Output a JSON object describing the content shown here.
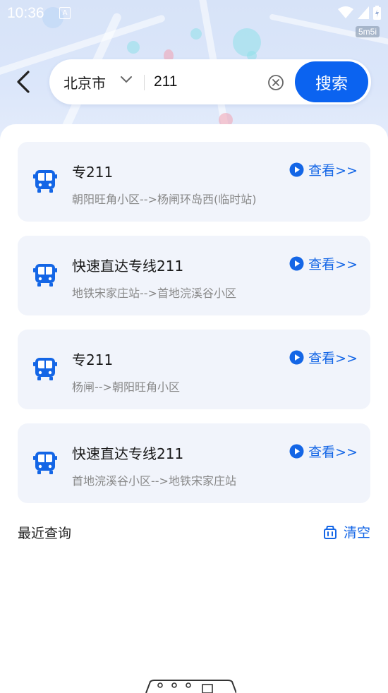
{
  "status_bar": {
    "time": "10:36",
    "notification_letter": "A",
    "badge": "5m5i"
  },
  "search": {
    "city": "北京市",
    "query": "211",
    "button_label": "搜索"
  },
  "results": [
    {
      "route": "专211",
      "stops": "朝阳旺角小区-->杨闸环岛西(临时站)",
      "view_label": "查看>>"
    },
    {
      "route": "快速直达专线211",
      "stops": "地铁宋家庄站-->首地浣溪谷小区",
      "view_label": "查看>>"
    },
    {
      "route": "专211",
      "stops": "杨闸-->朝阳旺角小区",
      "view_label": "查看>>"
    },
    {
      "route": "快速直达专线211",
      "stops": "首地浣溪谷小区-->地铁宋家庄站",
      "view_label": "查看>>"
    }
  ],
  "recent": {
    "title": "最近查询",
    "clear_label": "清空"
  },
  "colors": {
    "accent": "#0b63f0",
    "link": "#1466e6",
    "card_bg": "#f1f4fb"
  },
  "icons": {
    "back": "chevron-left-icon",
    "dropdown": "chevron-down-icon",
    "clear": "clear-circle-icon",
    "bus": "bus-icon",
    "play": "play-circle-icon",
    "trash": "trash-icon"
  }
}
